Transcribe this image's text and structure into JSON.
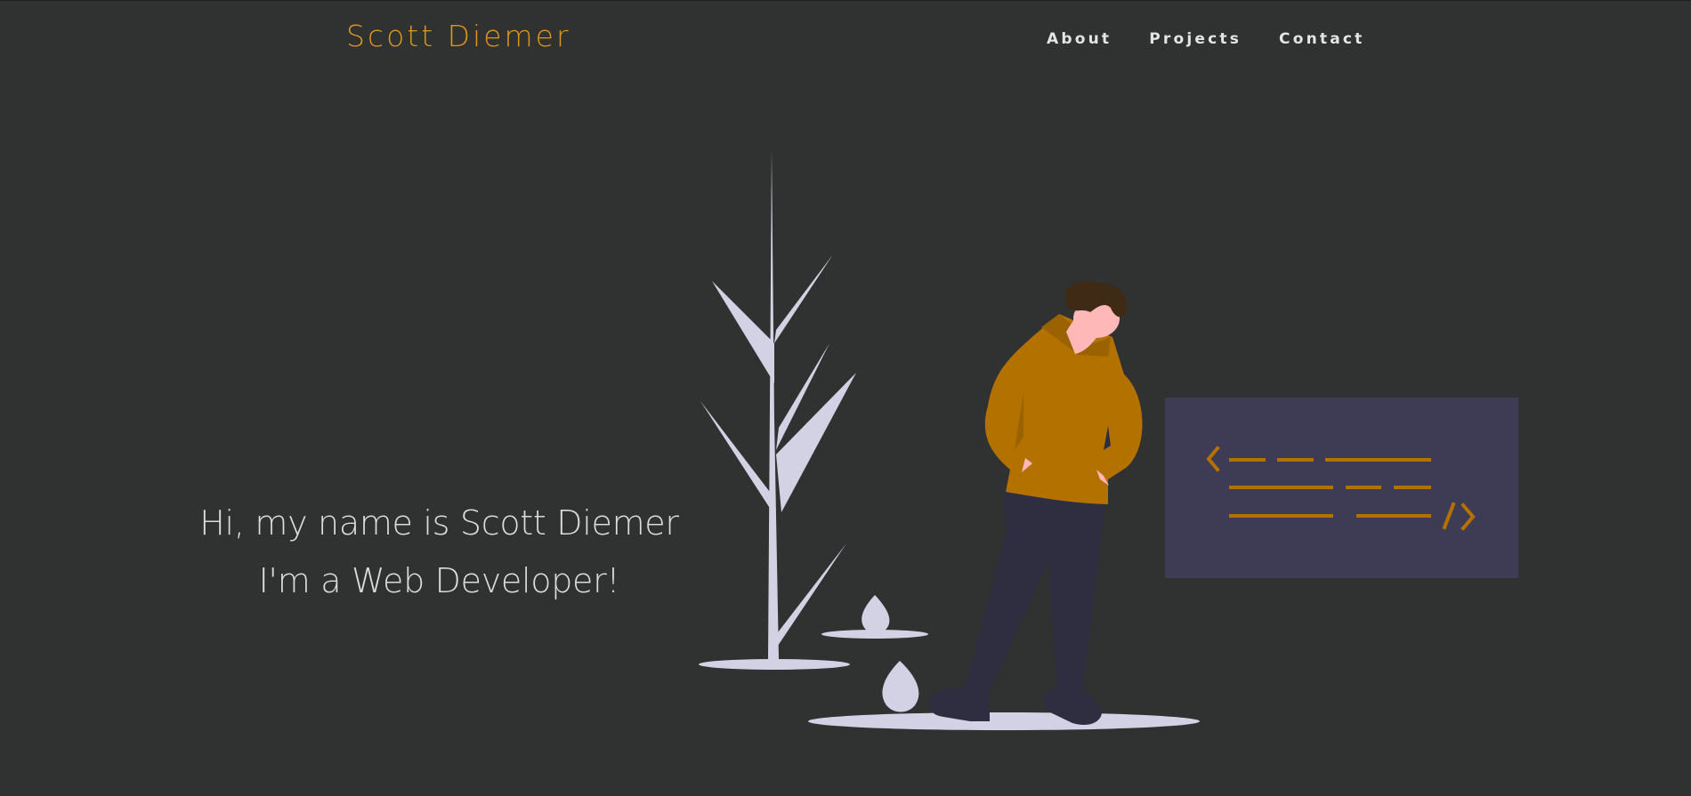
{
  "header": {
    "brand": "Scott Diemer",
    "nav": [
      "About",
      "Projects",
      "Contact"
    ]
  },
  "hero": {
    "line1": "Hi, my name is Scott Diemer",
    "line2": "I'm a Web Developer!"
  },
  "colors": {
    "background": "#303131",
    "accent": "#e0951f",
    "nav_text": "#e4e4e4",
    "hero_text": "#dcdcdc",
    "plant": "#d3d1e4",
    "hoodie": "#b37200",
    "code_panel": "#3e3b55"
  },
  "illustration": {
    "name": "developer-illustration",
    "code_glyphs": [
      "<",
      "/>"
    ]
  }
}
